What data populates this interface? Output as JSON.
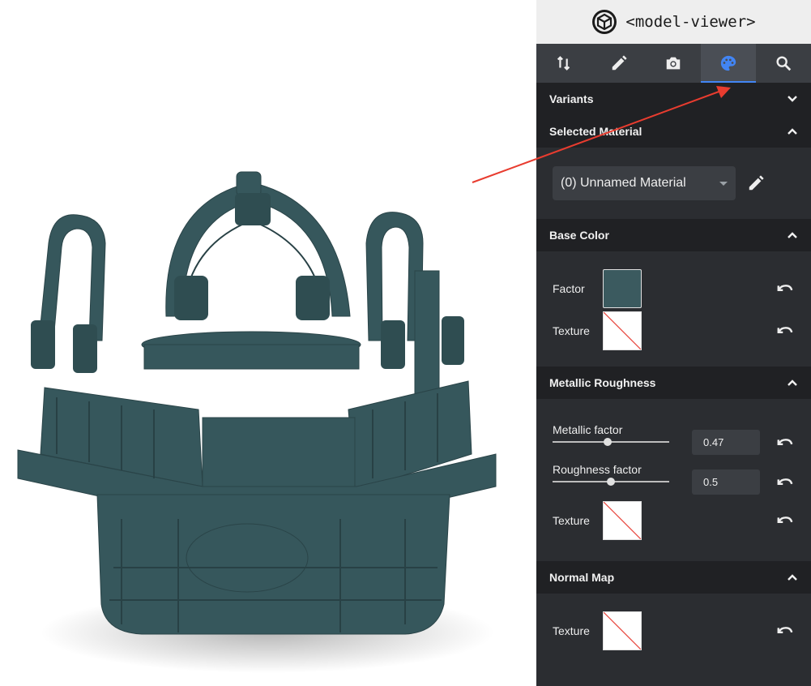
{
  "brand": {
    "title": "<model-viewer>",
    "icon": "model-viewer-cube-icon"
  },
  "tabs": [
    {
      "name": "sort-arrows",
      "active": false
    },
    {
      "name": "edit-pencil",
      "active": false
    },
    {
      "name": "camera",
      "active": false
    },
    {
      "name": "palette",
      "active": true
    },
    {
      "name": "search",
      "active": false
    }
  ],
  "colors": {
    "accent": "#4285f4",
    "model": "#36575c",
    "base_color_factor": "#3b5a5f",
    "annotation_arrow": "#e83c2f"
  },
  "sections": {
    "variants": {
      "title": "Variants",
      "expanded": false
    },
    "selected_material": {
      "title": "Selected Material",
      "expanded": true,
      "material_select_value": "(0) Unnamed Material"
    },
    "base_color": {
      "title": "Base Color",
      "expanded": true,
      "factor_label": "Factor",
      "texture_label": "Texture"
    },
    "metallic_roughness": {
      "title": "Metallic Roughness",
      "expanded": true,
      "metallic_label": "Metallic factor",
      "metallic_value": "0.47",
      "metallic_fraction": 0.47,
      "roughness_label": "Roughness factor",
      "roughness_value": "0.5",
      "roughness_fraction": 0.5,
      "texture_label": "Texture"
    },
    "normal_map": {
      "title": "Normal Map",
      "expanded": true,
      "texture_label": "Texture"
    }
  }
}
